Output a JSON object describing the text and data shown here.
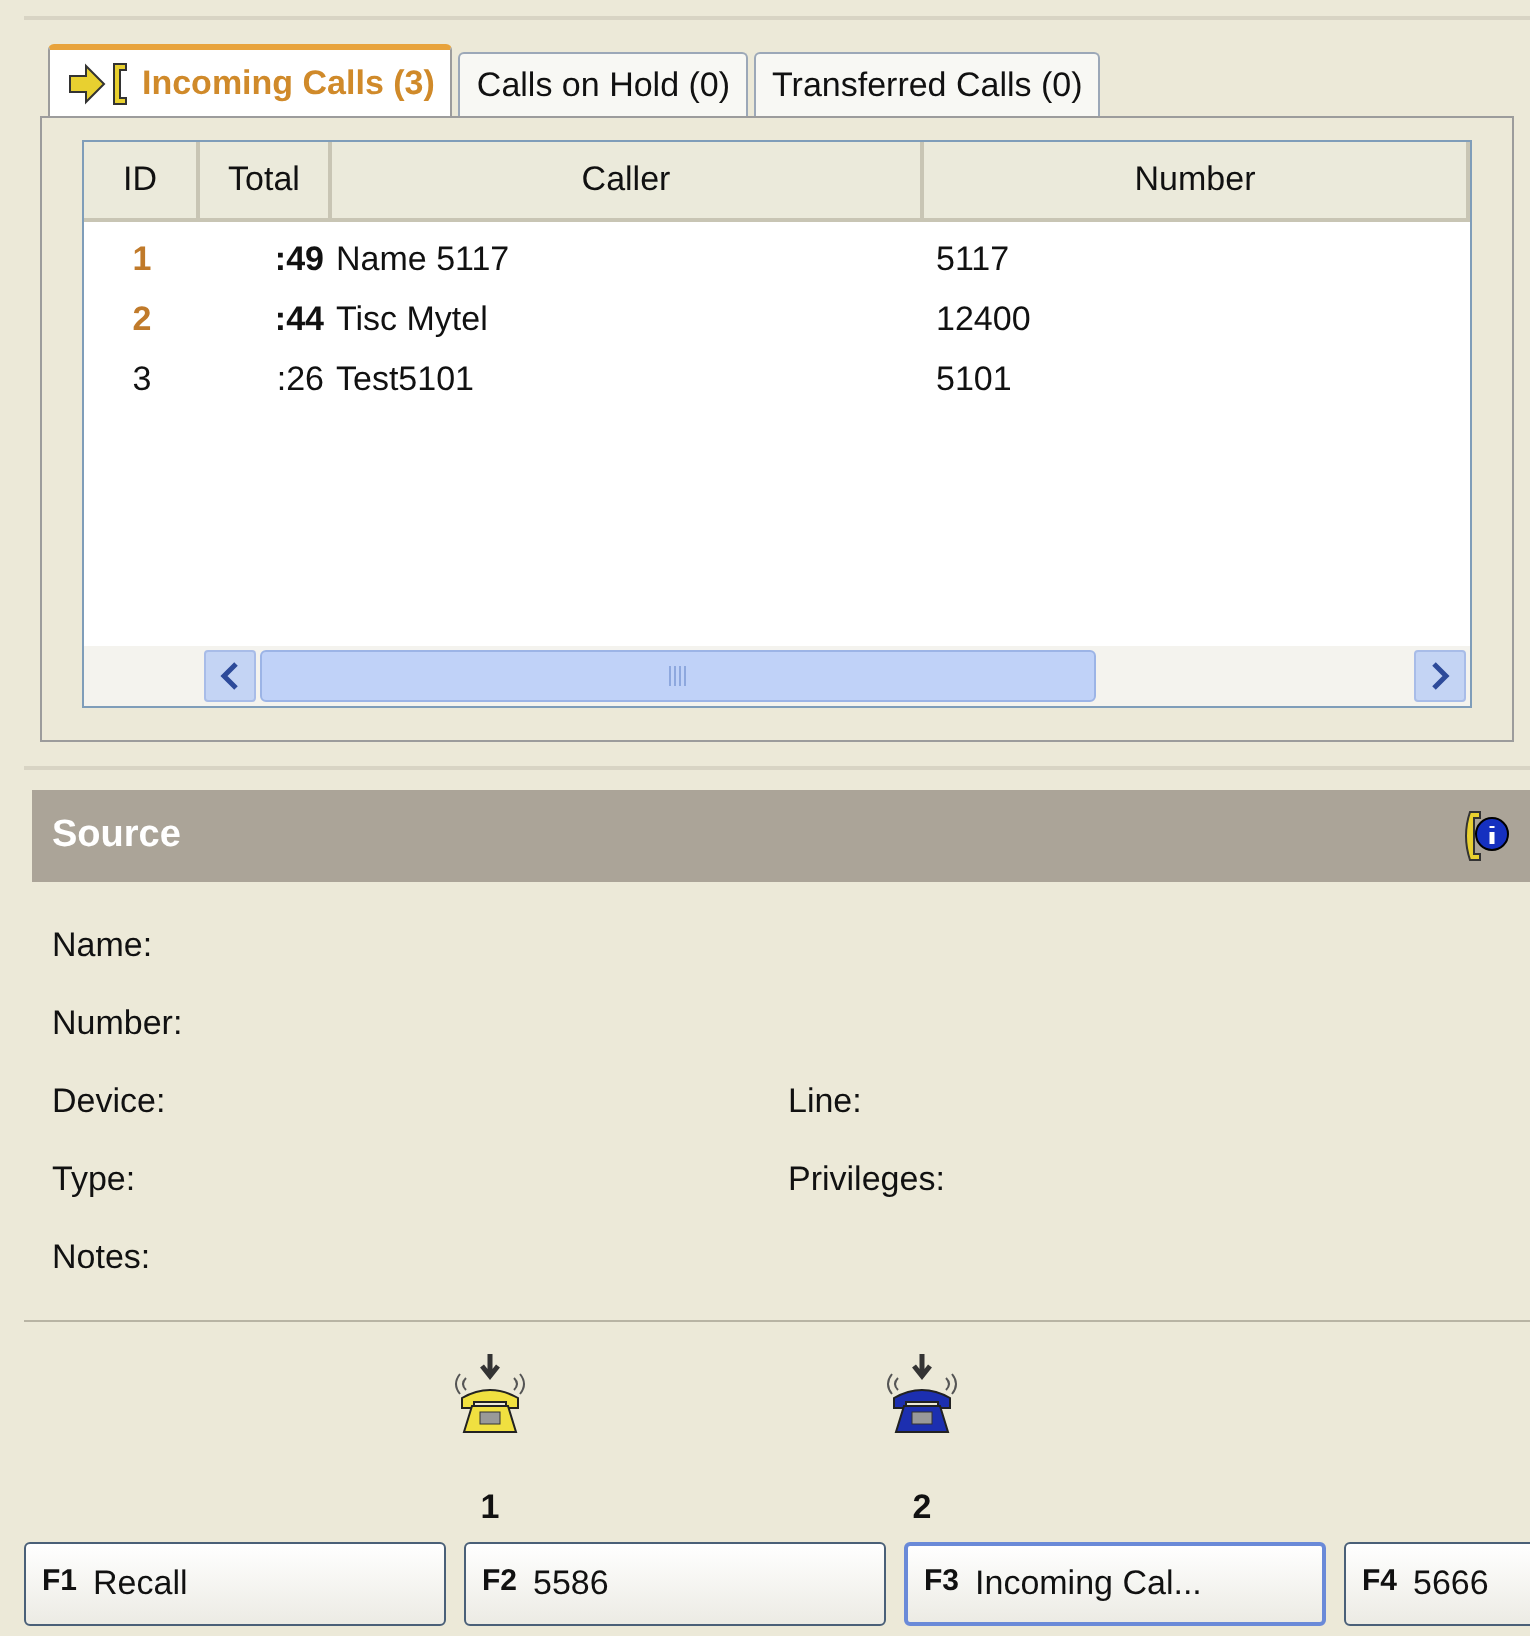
{
  "tabs": [
    {
      "label": "Incoming Calls (3)",
      "selected": true
    },
    {
      "label": "Calls on Hold (0)",
      "selected": false
    },
    {
      "label": "Transferred Calls (0)",
      "selected": false
    }
  ],
  "table": {
    "columns": [
      "ID",
      "Total",
      "Caller",
      "Number"
    ],
    "rows": [
      {
        "id": "1",
        "total": ":49",
        "caller": "Name 5117",
        "number": "5117",
        "highlighted": true
      },
      {
        "id": "2",
        "total": ":44",
        "caller": "Tisc Mytel",
        "number": "12400",
        "highlighted": true
      },
      {
        "id": "3",
        "total": ":26",
        "caller": "Test5101",
        "number": "5101",
        "highlighted": false
      }
    ]
  },
  "source": {
    "title": "Source",
    "fields": [
      {
        "label": "Name:"
      },
      {
        "label": "Number:"
      },
      {
        "label": "Device:",
        "label_2": "Line:"
      },
      {
        "label": "Type:",
        "label_2": "Privileges:"
      },
      {
        "label": "Notes:"
      }
    ]
  },
  "lines": [
    {
      "number": "1",
      "color": "#f0e040"
    },
    {
      "number": "2",
      "color": "#1c2fb0"
    }
  ],
  "keys": [
    {
      "key": "F1",
      "label": "Recall",
      "selected": false
    },
    {
      "key": "F2",
      "label": "5586",
      "selected": false
    },
    {
      "key": "F3",
      "label": "Incoming Cal...",
      "selected": true
    },
    {
      "key": "F4",
      "label": "5666",
      "selected": false
    }
  ]
}
